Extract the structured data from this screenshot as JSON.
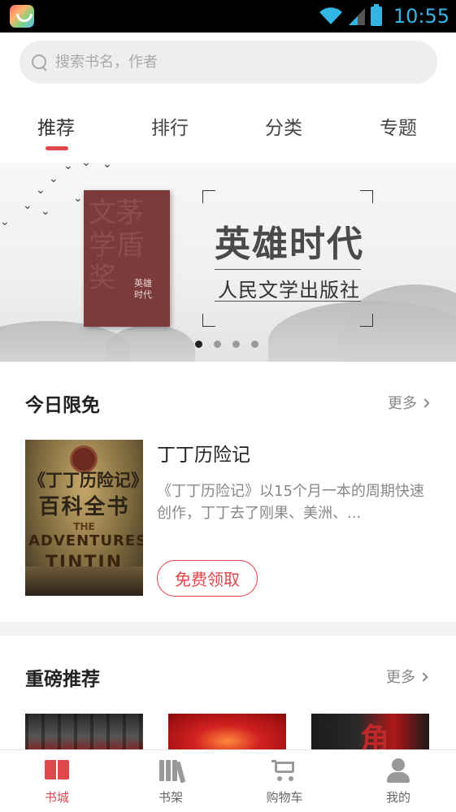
{
  "status_bar": {
    "time": "10:55"
  },
  "search": {
    "placeholder": "搜索书名，作者"
  },
  "tabs": [
    {
      "label": "推荐",
      "active": true
    },
    {
      "label": "排行"
    },
    {
      "label": "分类"
    },
    {
      "label": "专题"
    }
  ],
  "banner": {
    "title": "英雄时代",
    "publisher": "人民文学出版社",
    "book_cover_text": "英雄时代",
    "pages": 4,
    "active_page": 1
  },
  "free_today": {
    "section_title": "今日限免",
    "more_label": "更多",
    "book": {
      "title": "丁丁历险记",
      "description": "《丁丁历险记》以15个月一本的周期快速创作，丁丁去了刚果、美洲、...",
      "cover_lines": [
        "《丁丁历险记》",
        "百科全书",
        "THE",
        "ADVENTURES",
        "TINTIN"
      ],
      "button_label": "免费领取"
    }
  },
  "featured": {
    "section_title": "重磅推荐",
    "more_label": "更多",
    "cover3_text": "角"
  },
  "bottom_nav": [
    {
      "label": "书城",
      "icon": "book-open-icon",
      "active": true
    },
    {
      "label": "书架",
      "icon": "bookshelf-icon"
    },
    {
      "label": "购物车",
      "icon": "cart-icon"
    },
    {
      "label": "我的",
      "icon": "user-icon"
    }
  ],
  "colors": {
    "accent": "#e0474b",
    "status_blue": "#33b5e5"
  }
}
